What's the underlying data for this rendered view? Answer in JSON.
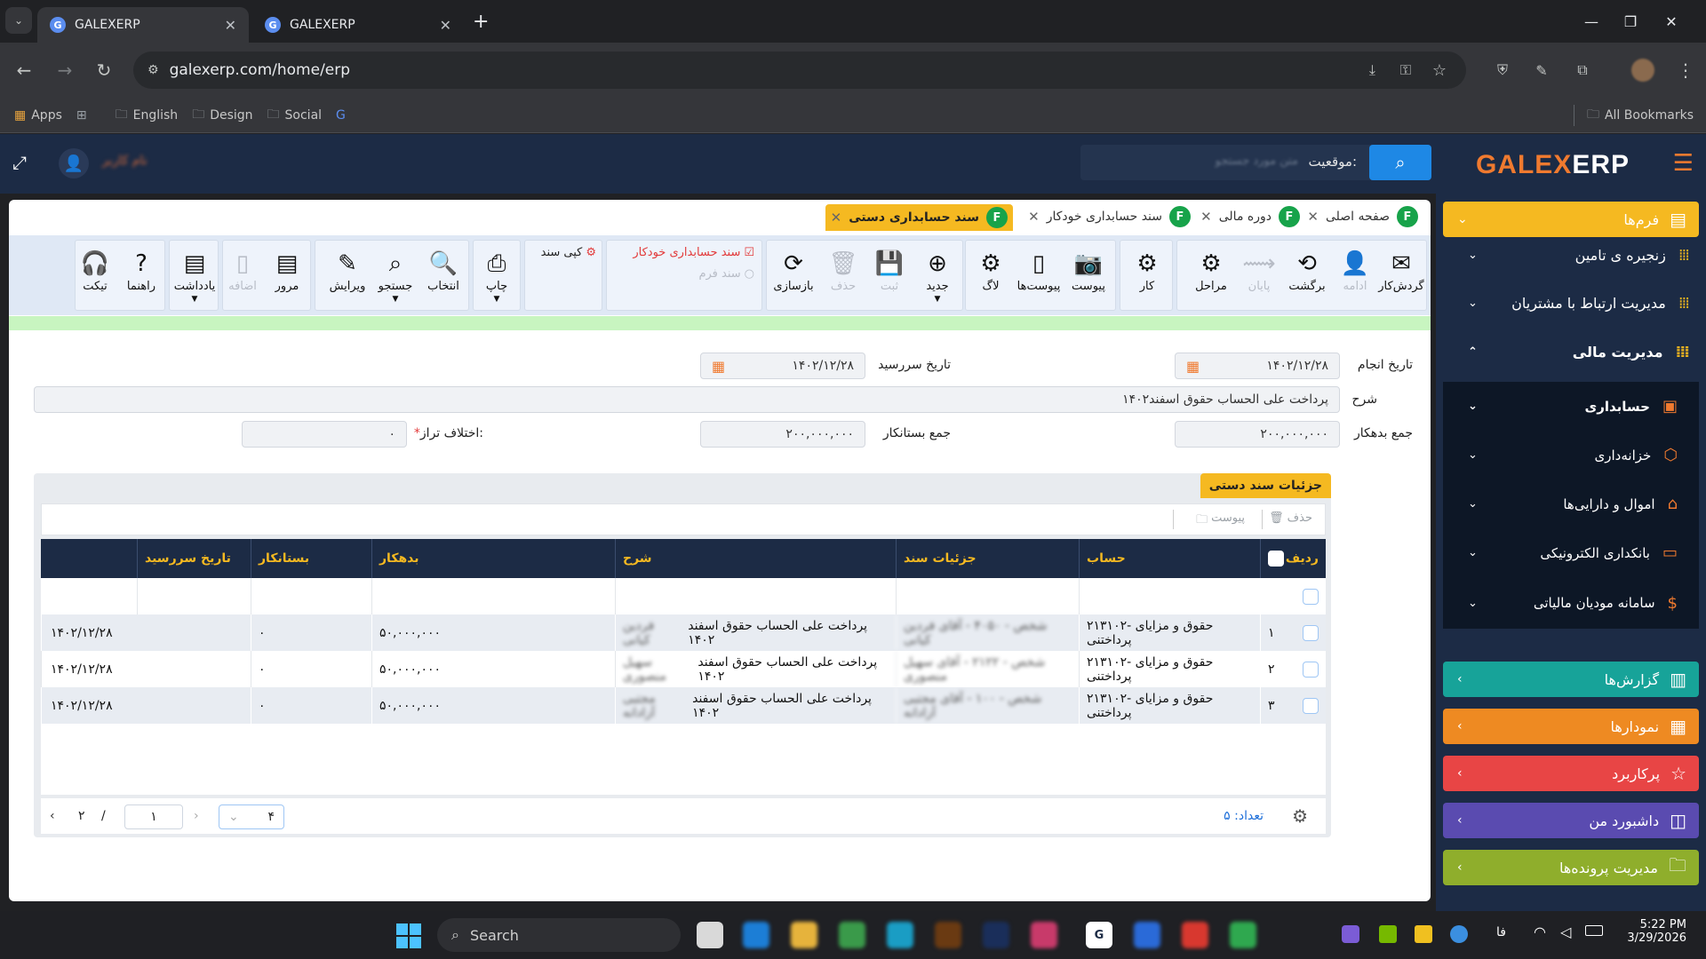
{
  "browser": {
    "tabs": [
      {
        "title": "GALEXERP",
        "active": true
      },
      {
        "title": "GALEXERP",
        "active": false
      }
    ],
    "url": "galexerp.com/home/erp",
    "bookmarks": [
      "Apps",
      "English",
      "Design",
      "Social"
    ],
    "all_bookmarks": "All Bookmarks"
  },
  "header": {
    "brand_part1": "GALEX",
    "brand_part2": "ERP",
    "search_label": "موقعیت:",
    "search_placeholder": "متن مورد جستجو",
    "user_name": "نام کاربر"
  },
  "sidebar": {
    "forms": "فرم‌ها",
    "items": [
      "زنجیره ی تامین",
      "مدیریت ارتباط با مشتریان",
      "مدیریت مالی"
    ],
    "subitems": [
      "حسابداری",
      "خزانه‌داری",
      "اموال و دارایی‌ها",
      "بانکداری الکترونیکی",
      "سامانه مودیان مالیاتی"
    ],
    "sections": [
      {
        "label": "گزارش‌ها",
        "color": "#17a399"
      },
      {
        "label": "نمودارها",
        "color": "#ee8a22"
      },
      {
        "label": "پرکاربرد",
        "color": "#e84545"
      },
      {
        "label": "داشبورد من",
        "color": "#5a4bb0"
      },
      {
        "label": "مدیریت پرونده‌ها",
        "color": "#8fae2c"
      }
    ]
  },
  "form_tabs": [
    {
      "label": "صفحه اصلی",
      "active": false
    },
    {
      "label": "دوره مالی",
      "active": false
    },
    {
      "label": "سند حسابداری خودکار",
      "active": false
    },
    {
      "label": "سند حسابداری دستی",
      "active": true
    }
  ],
  "ribbon": {
    "flow": [
      "گردش‌کار",
      "ادامه",
      "برگشت",
      "پایان",
      "مراحل"
    ],
    "work": "کار",
    "attach": [
      "پیوست",
      "پیوست‌ها"
    ],
    "log": "لاگ",
    "edit": [
      "جدید",
      "ثبت",
      "حذف",
      "بازسازی"
    ],
    "auto_doc": "سند حسابداری خودکار",
    "form_doc": "سند فرم",
    "copy_doc": "کپی سند",
    "print": "چاپ",
    "nav": [
      "انتخاب",
      "جستجو",
      "ویرایش",
      "مرور"
    ],
    "add": "اضافه",
    "note": "یادداشت",
    "help": "راهنما",
    "ticket": "تیکت"
  },
  "form": {
    "date_label": "تاریخ انجام",
    "date_value": "۱۴۰۲/۱۲/۲۸",
    "due_label": "تاریخ سررسید",
    "due_value": "۱۴۰۲/۱۲/۲۸",
    "desc_label": "شرح",
    "desc_value": "پرداخت علی الحساب حقوق اسفند۱۴۰۲",
    "debit_label": "جمع بدهکار",
    "debit_value": "۲۰۰,۰۰۰,۰۰۰",
    "credit_label": "جمع بستانکار",
    "credit_value": "۲۰۰,۰۰۰,۰۰۰",
    "diff_label": "اختلاف تراز:",
    "diff_value": "۰"
  },
  "details": {
    "title": "جزئیات سند دستی",
    "delete": "حذف",
    "attach": "پیوست",
    "columns": [
      "ردیف",
      "حساب",
      "جزئیات سند",
      "شرح",
      "بدهکار",
      "بستانکار",
      "تاریخ سررسید"
    ],
    "rows": [
      {
        "no": "۱",
        "account": "۲۱۳۱۰۲- حقوق و مزایای پرداختنی",
        "detail": "شخص - ۴۰۵۰ - آقای فردین کیانی",
        "desc": "پرداخت علی الحساب حقوق اسفند ۱۴۰۲",
        "desc_blur": "فردین کیانی",
        "debit": "۵۰,۰۰۰,۰۰۰",
        "credit": "۰",
        "due": "۱۴۰۲/۱۲/۲۸"
      },
      {
        "no": "۲",
        "account": "۲۱۳۱۰۲- حقوق و مزایای پرداختنی",
        "detail": "شخص - ۲۱۲۲ - آقای سهیل منصوری",
        "desc": "پرداخت علی الحساب حقوق اسفند ۱۴۰۲",
        "desc_blur": "سهیل منصوری",
        "debit": "۵۰,۰۰۰,۰۰۰",
        "credit": "۰",
        "due": "۱۴۰۲/۱۲/۲۸"
      },
      {
        "no": "۳",
        "account": "۲۱۳۱۰۲- حقوق و مزایای پرداختنی",
        "detail": "شخص - ۱۰۰ - آقای مجتبی آزادانه",
        "desc": "پرداخت علی الحساب حقوق اسفند ۱۴۰۲",
        "desc_blur": "مجتبی آزادانه",
        "debit": "۵۰,۰۰۰,۰۰۰",
        "credit": "۰",
        "due": "۱۴۰۲/۱۲/۲۸"
      }
    ],
    "count_label": "تعداد: ۵",
    "page_size": "۴",
    "page_current": "۱",
    "page_total": "۲"
  },
  "taskbar": {
    "search": "Search",
    "lang": "فا",
    "time": "5:22 PM",
    "date": "3/29/2026"
  }
}
